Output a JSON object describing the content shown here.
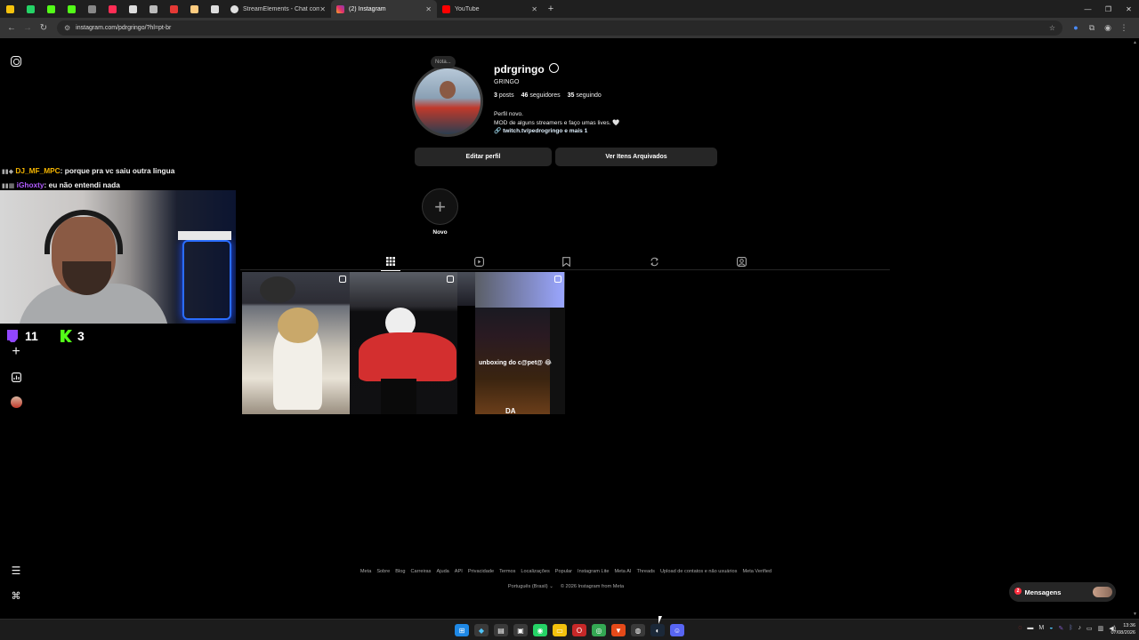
{
  "browser": {
    "tabs": [
      {
        "label": "StreamElements - Chat command",
        "color": "#e0e0e0",
        "active": false
      },
      {
        "label": "(2) Instagram",
        "color": "#e1306c",
        "active": true
      },
      {
        "label": "YouTube",
        "color": "#ff0000",
        "active": false
      }
    ],
    "pinned_colors": [
      "#f4c20d",
      "#25d366",
      "#53fc18",
      "#53fc18",
      "#888888",
      "#ff2d55",
      "#dddddd",
      "#bbbbbb",
      "#e53935",
      "#ffcc80",
      "#dddddd"
    ],
    "url": "instagram.com/pdrgringo/?hl=pt-br"
  },
  "overlay": {
    "chat": [
      {
        "user": "DJ_MF_MPC",
        "user_color": "#f4b400",
        "text": "porque pra vc saiu outra lingua"
      },
      {
        "user": "iGhoxty",
        "user_color": "#b15cff",
        "text": "eu não entendi nada"
      }
    ],
    "twitch_viewers": "11",
    "kick_viewers": "3"
  },
  "profile": {
    "note": "Nota...",
    "username": "pdrgringo",
    "full_name": "GRINGO",
    "posts_count": "3",
    "posts_label": "posts",
    "followers_count": "46",
    "followers_label": "seguidores",
    "following_count": "35",
    "following_label": "seguindo",
    "bio_line1": "Perfil novo.",
    "bio_line2": "MOD de alguns streamers e faço umas lives. 🤍",
    "link": "twitch.tv/pedrogringo e mais 1",
    "edit_button": "Editar perfil",
    "archive_button": "Ver Itens Arquivados",
    "new_story_label": "Novo"
  },
  "posts": [
    {
      "caption": ""
    },
    {
      "caption": ""
    },
    {
      "caption": "unboxing do c@pet@ 😂",
      "overlay": "DA"
    }
  ],
  "footer": {
    "links": [
      "Meta",
      "Sobre",
      "Blog",
      "Carreiras",
      "Ajuda",
      "API",
      "Privacidade",
      "Termos",
      "Localizações",
      "Popular",
      "Instagram Lite",
      "Meta AI",
      "Threads",
      "Upload de contatos e não usuários",
      "Meta Verified"
    ],
    "language": "Português (Brasil)",
    "copyright": "© 2026 Instagram from Meta"
  },
  "messages": {
    "label": "Mensagens",
    "badge": "2"
  },
  "clock": {
    "time": "13:36",
    "date": "07/08/2026"
  }
}
